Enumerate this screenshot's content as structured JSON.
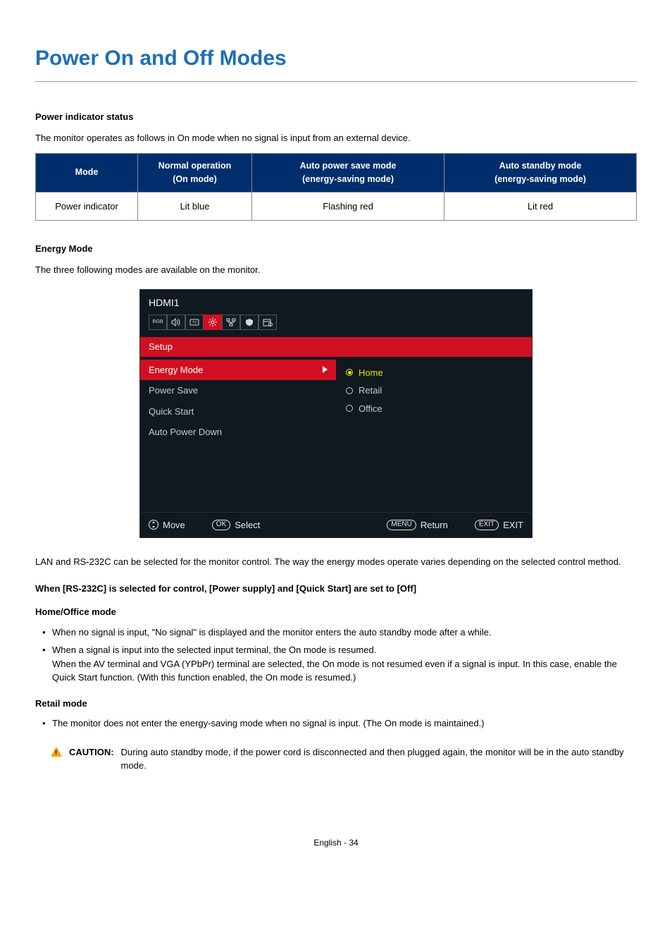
{
  "title": "Power On and Off Modes",
  "sections": {
    "pis": {
      "head": "Power indicator status",
      "intro": "The monitor operates as follows in On mode when no signal is input from an external device.",
      "table": {
        "h1": "Mode",
        "h2a": "Normal operation",
        "h2b": "(On mode)",
        "h3a": "Auto power save mode",
        "h3b": "(energy-saving mode)",
        "h4a": "Auto standby mode",
        "h4b": "(energy-saving mode)",
        "r1c1": "Power indicator",
        "r1c2": "Lit blue",
        "r1c3": "Flashing red",
        "r1c4": "Lit red"
      }
    },
    "em": {
      "head": "Energy Mode",
      "intro": "The three following modes are available on the monitor."
    }
  },
  "osd": {
    "source": "HDMI1",
    "category": "Setup",
    "items": {
      "energy": "Energy Mode",
      "powersave": "Power Save",
      "quickstart": "Quick Start",
      "autopower": "Auto Power Down"
    },
    "options": {
      "home": "Home",
      "retail": "Retail",
      "office": "Office"
    },
    "footer": {
      "move": "Move",
      "ok": "OK",
      "select": "Select",
      "menu": "MENU",
      "return": "Return",
      "exitkey": "EXIT",
      "exit": "EXIT"
    }
  },
  "after_osd": "LAN and RS-232C can be selected for the monitor control. The way the energy modes operate varies depending on the selected control method.",
  "rs232": {
    "head": "When [RS-232C] is selected for control, [Power supply] and [Quick Start] are set to [Off]",
    "home_head": "Home/Office mode",
    "home_b1": "When no signal is input, \"No signal\" is displayed and the monitor enters the auto standby mode after a while.",
    "home_b2a": "When a signal is input into the selected input terminal, the On mode is resumed.",
    "home_b2b": "When the AV terminal and VGA (YPbPr) terminal are selected, the On mode is not resumed even if a signal is input. In this case, enable the Quick Start function. (With this function enabled, the On mode is resumed.)",
    "retail_head": "Retail mode",
    "retail_b1": "The monitor does not enter the energy-saving mode when no signal is input. (The On mode is maintained.)"
  },
  "caution": {
    "label": "CAUTION:",
    "text": "During auto standby mode, if the power cord is disconnected and then plugged again, the monitor will be in the auto standby mode."
  },
  "footer": "English - 34"
}
